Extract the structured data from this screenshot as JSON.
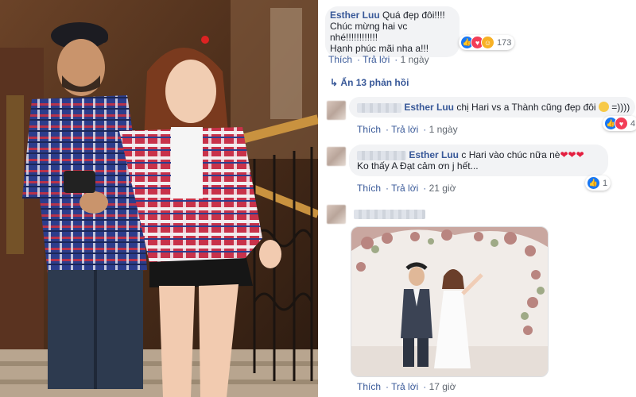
{
  "comment1": {
    "author": "Esther Luu",
    "lines": [
      "Quá đẹp đôi!!!!",
      "Chúc mừng hai vc nhé!!!!!!!!!!!!",
      "Hạnh phúc mãi nha a!!!"
    ],
    "reaction_count": "173",
    "reactions": [
      "like-icon",
      "love-icon",
      "haha-icon"
    ],
    "actions": {
      "like": "Thích",
      "reply": "Trả lời",
      "time": "1 ngày"
    }
  },
  "hidden_replies": {
    "label": "Ẩn 13 phản hồi",
    "icon": "reply-arrow-icon"
  },
  "reply1": {
    "mention": "Esther Luu",
    "text": "chị Hari vs a Thành cũng đẹp đôi",
    "trailing": "=))))",
    "emoji": "laughing-cat-icon",
    "reaction_count": "4",
    "actions": {
      "like": "Thích",
      "reply": "Trả lời",
      "time": "1 ngày"
    }
  },
  "reply2": {
    "mention": "Esther Luu",
    "text_line1": "c Hari vào chúc nữa nè",
    "hearts": "❤❤❤",
    "text_line2": "Ko thấy A Đạt cảm ơn j hết...",
    "reaction_count": "1",
    "actions": {
      "like": "Thích",
      "reply": "Trả lời",
      "time": "21 giờ"
    }
  },
  "reply3": {
    "attachment": "wedding-photo",
    "actions": {
      "like": "Thích",
      "reply": "Trả lời",
      "time": "17 giờ"
    }
  },
  "colors": {
    "link": "#385898",
    "bubble": "#f2f3f5",
    "like": "#1877f2",
    "love": "#f33e58",
    "haha": "#f7b125"
  }
}
